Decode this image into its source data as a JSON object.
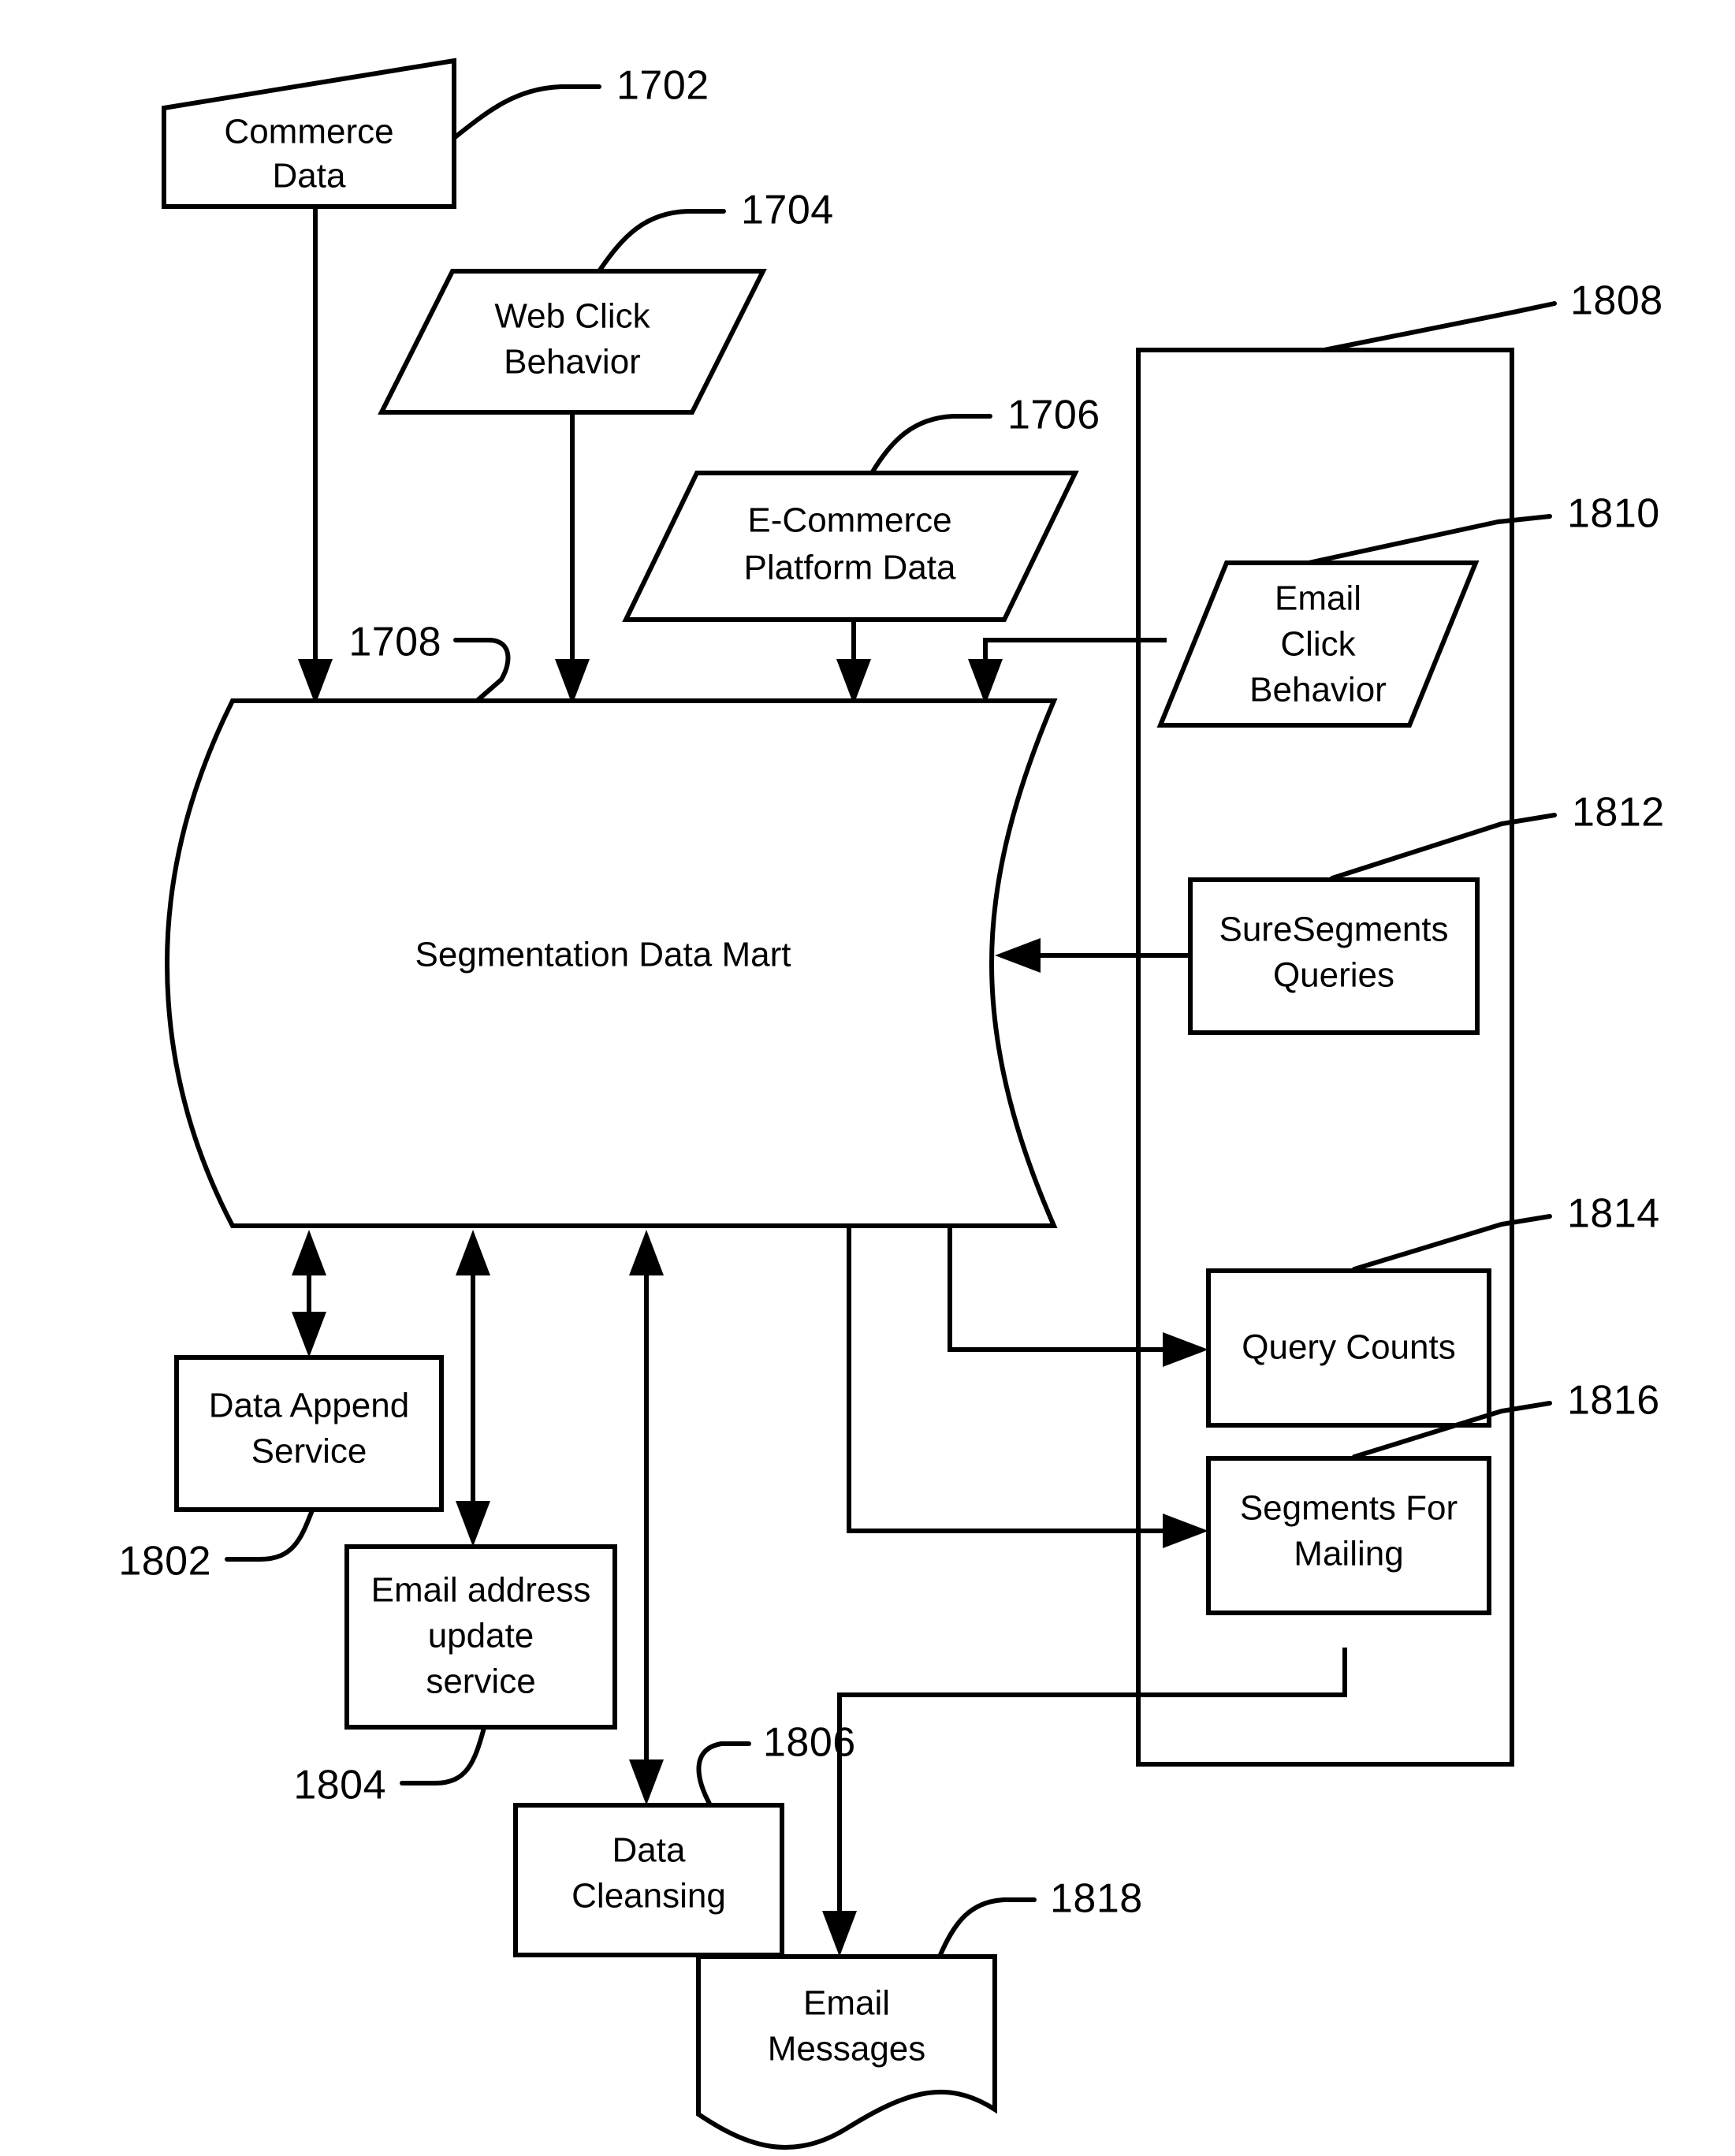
{
  "figure": {
    "type": "patent-flow-diagram",
    "nodes": [
      {
        "id": "commerce-data",
        "label_line1": "Commerce",
        "label_line2": "Data",
        "shape": "skewed-rectangle"
      },
      {
        "id": "web-click-behavior",
        "label_line1": "Web Click",
        "label_line2": "Behavior",
        "shape": "parallelogram"
      },
      {
        "id": "ecommerce-platform",
        "label_line1": "E-Commerce",
        "label_line2": "Platform Data",
        "shape": "parallelogram"
      },
      {
        "id": "segmentation-data-mart",
        "label_line1": "Segmentation Data Mart",
        "label_line2": "",
        "shape": "barrel-cylinder"
      },
      {
        "id": "email-click-behavior",
        "label_line1": "Email",
        "label_line2": "Click",
        "label_line3": "Behavior",
        "shape": "parallelogram"
      },
      {
        "id": "suresegments-queries",
        "label_line1": "SureSegments",
        "label_line2": "Queries",
        "shape": "rectangle"
      },
      {
        "id": "query-counts",
        "label_line1": "Query Counts",
        "label_line2": "",
        "shape": "rectangle"
      },
      {
        "id": "segments-for-mailing",
        "label_line1": "Segments For",
        "label_line2": "Mailing",
        "shape": "rectangle"
      },
      {
        "id": "data-append-service",
        "label_line1": "Data Append",
        "label_line2": "Service",
        "shape": "rectangle"
      },
      {
        "id": "email-address-update",
        "label_line1": "Email address",
        "label_line2": "update",
        "label_line3": "service",
        "shape": "rectangle"
      },
      {
        "id": "data-cleansing",
        "label_line1": "Data",
        "label_line2": "Cleansing",
        "shape": "rectangle"
      },
      {
        "id": "email-messages",
        "label_line1": "Email",
        "label_line2": "Messages",
        "shape": "document-wavy"
      },
      {
        "id": "email-system-group",
        "label_line1": "",
        "label_line2": "",
        "shape": "container-rectangle"
      }
    ],
    "reference_numerals": [
      {
        "id": "ref-1702",
        "text": "1702",
        "target": "commerce-data"
      },
      {
        "id": "ref-1704",
        "text": "1704",
        "target": "web-click-behavior"
      },
      {
        "id": "ref-1706",
        "text": "1706",
        "target": "ecommerce-platform"
      },
      {
        "id": "ref-1708",
        "text": "1708",
        "target": "segmentation-data-mart"
      },
      {
        "id": "ref-1802",
        "text": "1802",
        "target": "data-append-service"
      },
      {
        "id": "ref-1804",
        "text": "1804",
        "target": "email-address-update"
      },
      {
        "id": "ref-1806",
        "text": "1806",
        "target": "data-cleansing"
      },
      {
        "id": "ref-1808",
        "text": "1808",
        "target": "email-system-group"
      },
      {
        "id": "ref-1810",
        "text": "1810",
        "target": "email-click-behavior"
      },
      {
        "id": "ref-1812",
        "text": "1812",
        "target": "suresegments-queries"
      },
      {
        "id": "ref-1814",
        "text": "1814",
        "target": "query-counts"
      },
      {
        "id": "ref-1816",
        "text": "1816",
        "target": "segments-for-mailing"
      },
      {
        "id": "ref-1818",
        "text": "1818",
        "target": "email-messages"
      }
    ],
    "edges": [
      {
        "from": "commerce-data",
        "to": "segmentation-data-mart",
        "arrow": "single"
      },
      {
        "from": "web-click-behavior",
        "to": "segmentation-data-mart",
        "arrow": "single"
      },
      {
        "from": "ecommerce-platform",
        "to": "segmentation-data-mart",
        "arrow": "single"
      },
      {
        "from": "email-click-behavior",
        "to": "segmentation-data-mart",
        "arrow": "single"
      },
      {
        "from": "suresegments-queries",
        "to": "segmentation-data-mart",
        "arrow": "single"
      },
      {
        "from": "segmentation-data-mart",
        "to": "data-append-service",
        "arrow": "double"
      },
      {
        "from": "segmentation-data-mart",
        "to": "email-address-update",
        "arrow": "double"
      },
      {
        "from": "segmentation-data-mart",
        "to": "data-cleansing",
        "arrow": "double"
      },
      {
        "from": "segmentation-data-mart",
        "to": "query-counts",
        "arrow": "single"
      },
      {
        "from": "segmentation-data-mart",
        "to": "segments-for-mailing",
        "arrow": "single"
      },
      {
        "from": "segments-for-mailing",
        "to": "email-messages",
        "arrow": "single"
      }
    ],
    "colors": {
      "stroke": "#000000",
      "fill": "#ffffff",
      "background": "#ffffff"
    }
  }
}
